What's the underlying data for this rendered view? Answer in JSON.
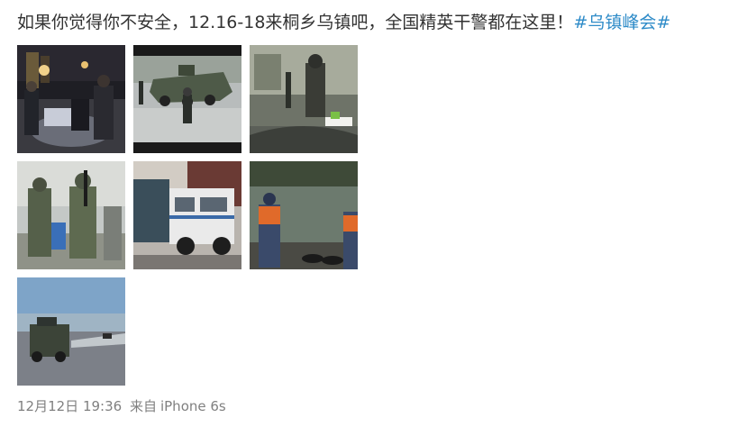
{
  "post": {
    "text": "如果你觉得你不安全，12.16-18来桐乡乌镇吧，全国精英干警都在这里！",
    "hashtag": "#乌镇峰会#"
  },
  "photos": [
    {
      "icon": "night-police-photo"
    },
    {
      "icon": "armored-vehicle-photo"
    },
    {
      "icon": "armed-officer-windshield-photo"
    },
    {
      "icon": "armed-soldiers-photo"
    },
    {
      "icon": "police-trucks-photo"
    },
    {
      "icon": "lakeside-guard-photo"
    },
    {
      "icon": "highway-armored-vehicle-photo"
    }
  ],
  "meta": {
    "date": "12月12日 19:36",
    "from_label": "来自",
    "device": "iPhone 6s"
  }
}
